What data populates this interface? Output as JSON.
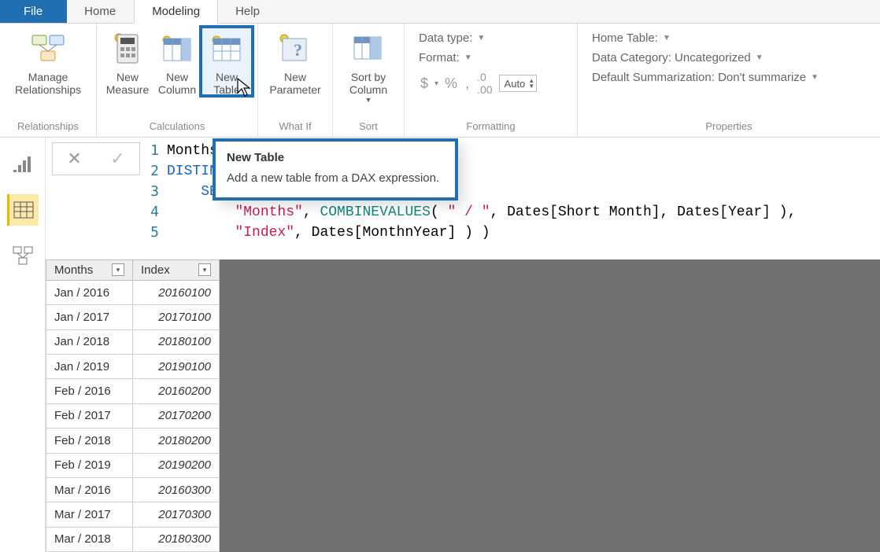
{
  "menubar": {
    "file": "File",
    "home": "Home",
    "modeling": "Modeling",
    "help": "Help"
  },
  "ribbon": {
    "relationships": {
      "label": "Relationships",
      "manage": "Manage\nRelationships"
    },
    "calculations": {
      "label": "Calculations",
      "measure": "New\nMeasure",
      "column": "New\nColumn",
      "table": "New\nTable"
    },
    "whatif": {
      "label": "What If",
      "parameter": "New\nParameter"
    },
    "sort": {
      "label": "Sort",
      "sortby": "Sort by\nColumn"
    },
    "formatting": {
      "label": "Formatting",
      "datatype": "Data type:",
      "format": "Format:",
      "auto": "Auto"
    },
    "properties": {
      "label": "Properties",
      "hometable": "Home Table:",
      "datacategory": "Data Category: Uncategorized",
      "summarization": "Default Summarization: Don't summarize"
    }
  },
  "tooltip": {
    "title": "New Table",
    "body": "Add a new table from a DAX expression."
  },
  "code": {
    "l1": "Months Year =",
    "l2": "DISTINCT(",
    "l3_a": "SELECTCOLUMNS(",
    "l4_a": "\"Months\"",
    "l4_b": "COMBINEVALUES",
    "l4_c": "\" / \"",
    "l4_d": "Dates[Short Month], Dates[Year] ),",
    "l5_a": "\"Index\"",
    "l5_b": "Dates[MonthnYear] ) )"
  },
  "grid": {
    "headers": [
      "Months",
      "Index"
    ],
    "rows": [
      [
        "Jan / 2016",
        "20160100"
      ],
      [
        "Jan / 2017",
        "20170100"
      ],
      [
        "Jan / 2018",
        "20180100"
      ],
      [
        "Jan / 2019",
        "20190100"
      ],
      [
        "Feb / 2016",
        "20160200"
      ],
      [
        "Feb / 2017",
        "20170200"
      ],
      [
        "Feb / 2018",
        "20180200"
      ],
      [
        "Feb / 2019",
        "20190200"
      ],
      [
        "Mar / 2016",
        "20160300"
      ],
      [
        "Mar / 2017",
        "20170300"
      ],
      [
        "Mar / 2018",
        "20180300"
      ]
    ]
  }
}
